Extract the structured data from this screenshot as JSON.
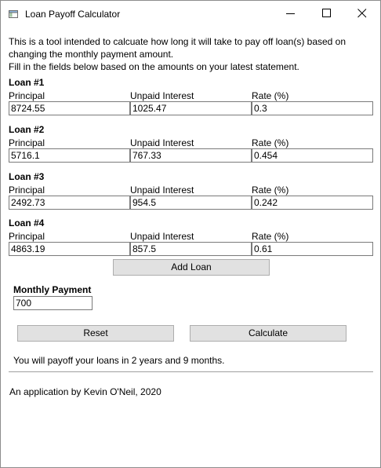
{
  "window": {
    "title": "Loan Payoff Calculator",
    "icon": "app-window-icon",
    "controls": [
      "minimize-icon",
      "maximize-icon",
      "close-icon"
    ]
  },
  "intro": {
    "line1": "This is a tool intended to calcuate how long it will take to pay off loan(s) based on",
    "line2": "changing the monthly payment amount.",
    "line3": "Fill in the fields below based on the amounts on your latest statement."
  },
  "labels": {
    "principal": "Principal",
    "unpaid_interest": "Unpaid Interest",
    "rate": "Rate (%)"
  },
  "loans": [
    {
      "heading": "Loan #1",
      "principal": "8724.55",
      "unpaid_interest": "1025.47",
      "rate": "0.3"
    },
    {
      "heading": "Loan #2",
      "principal": "5716.1",
      "unpaid_interest": "767.33",
      "rate": "0.454"
    },
    {
      "heading": "Loan #3",
      "principal": "2492.73",
      "unpaid_interest": "954.5",
      "rate": "0.242"
    },
    {
      "heading": "Loan #4",
      "principal": "4863.19",
      "unpaid_interest": "857.5",
      "rate": "0.61"
    }
  ],
  "buttons": {
    "add_loan": "Add Loan",
    "reset": "Reset",
    "calculate": "Calculate"
  },
  "monthly_payment": {
    "label": "Monthly Payment",
    "value": "700"
  },
  "result": "You will payoff your loans in 2 years and 9 months.",
  "footer": "An application by Kevin O'Neil, 2020",
  "colors": {
    "button_bg": "#e1e1e1",
    "button_border": "#adadad",
    "field_border": "#7a7a7a",
    "divider": "#a0a0a0"
  }
}
